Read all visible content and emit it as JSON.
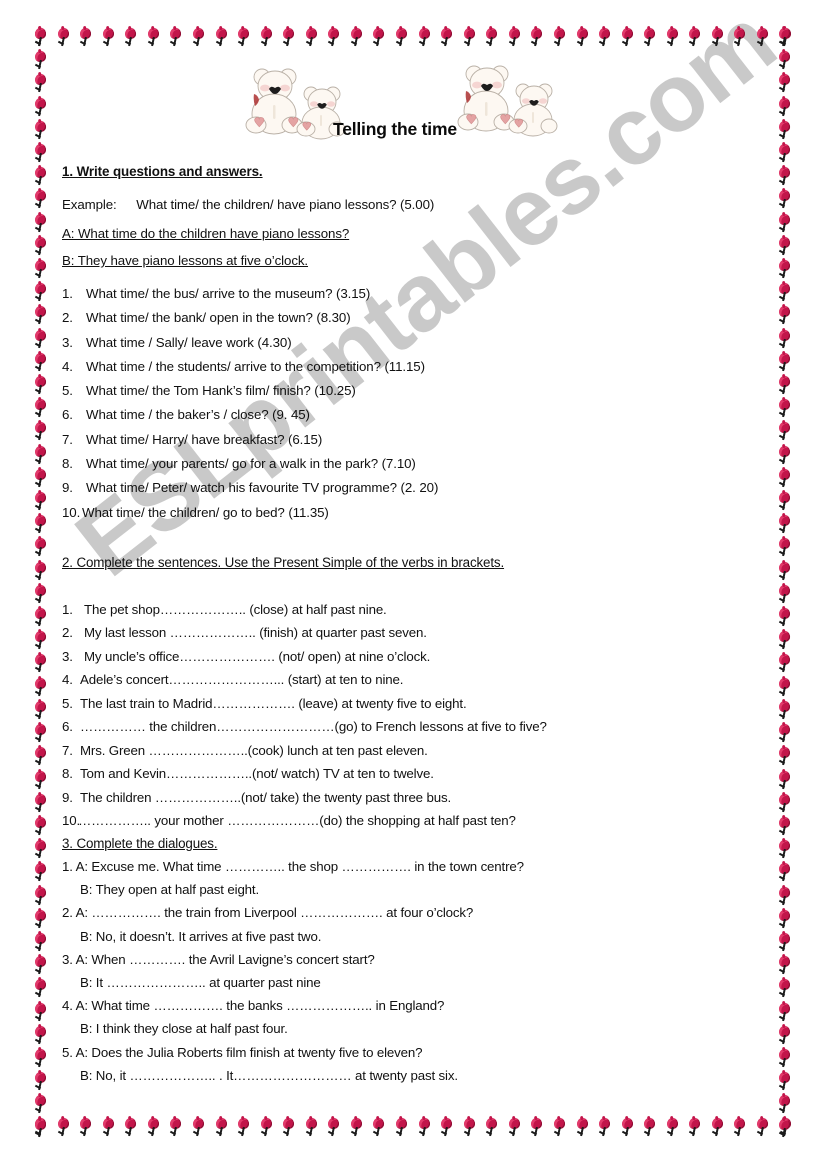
{
  "document": {
    "title": "Telling the time",
    "watermark": "ESLprintables.com",
    "decor": {
      "border_motif": "cherry",
      "border_color": "#c2154a",
      "bear_left": "teddy-bears-clipart",
      "bear_right": "teddy-bears-clipart"
    }
  },
  "section1": {
    "heading": "1. Write questions and answers.",
    "example_label": "Example:",
    "example_prompt": "What time/ the children/ have piano lessons? (5.00)",
    "answer_a": "A: What time do the children have piano lessons?",
    "answer_b": "B: They have piano lessons at five o’clock.",
    "items": [
      {
        "num": "1.",
        "text": "What time/ the bus/ arrive to the museum? (3.15)"
      },
      {
        "num": "2.",
        "text": "What time/ the bank/ open in the town? (8.30)"
      },
      {
        "num": "3.",
        "text": "What time / Sally/ leave work (4.30)"
      },
      {
        "num": "4.",
        "text": "What time / the students/ arrive to the competition? (11.15)"
      },
      {
        "num": "5.",
        "text": "What time/ the Tom Hank’s film/ finish? (10.25)"
      },
      {
        "num": "6.",
        "text": "What time / the baker’s / close? (9. 45)"
      },
      {
        "num": "7.",
        "text": "What time/ Harry/ have breakfast? (6.15)"
      },
      {
        "num": "8.",
        "text": "What time/ your parents/ go for a walk in the park? (7.10)"
      },
      {
        "num": "9.",
        "text": "What time/ Peter/ watch his favourite TV programme? (2. 20)"
      },
      {
        "num": "10.",
        "text": "What time/ the children/ go to bed? (11.35)"
      }
    ]
  },
  "section2": {
    "heading": "2. Complete the sentences. Use the Present Simple of the verbs in brackets.",
    "items": [
      {
        "num": "1.",
        "text": "The pet shop……………….. (close) at half past nine."
      },
      {
        "num": "2.",
        "text": "My last lesson ……………….. (finish) at quarter past seven."
      },
      {
        "num": "3.",
        "text": "My uncle’s office…………………. (not/ open) at nine o’clock."
      },
      {
        "num": "4.",
        "text": "Adele’s concert……………………... (start) at ten to nine."
      },
      {
        "num": "5.",
        "text": "The last train to Madrid………………. (leave) at twenty five to eight."
      },
      {
        "num": "6.",
        "text": "…………… the children………………………(go) to French lessons at five to five?"
      },
      {
        "num": "7.",
        "text": "Mrs. Green …………………..(cook) lunch at ten past eleven."
      },
      {
        "num": "8.",
        "text": "Tom and Kevin………………..(not/ watch) TV at ten to twelve."
      },
      {
        "num": "9.",
        "text": "The children ………………..(not/ take) the twenty past three bus."
      },
      {
        "num": "10.",
        "text": "…………….. your mother …………………(do) the shopping at half past ten?"
      }
    ]
  },
  "section3": {
    "heading": "3. Complete the dialogues.",
    "items": [
      {
        "a": "1. A: Excuse me. What time ………….. the shop ……………. in the town centre?",
        "b": "B: They open at half past eight."
      },
      {
        "a": "2. A: ……………. the train from Liverpool ………………. at four o’clock?",
        "b": "B: No, it doesn’t. It arrives at five past two."
      },
      {
        "a": "3. A: When …………. the Avril Lavigne’s concert start?",
        "b": "B: It ………………….. at quarter past nine"
      },
      {
        "a": "4. A: What time ……………. the banks ……………….. in England?",
        "b": "B: I think they close at half past four."
      },
      {
        "a": "5. A: Does the Julia Roberts film finish at twenty five  to eleven?",
        "b": "B: No, it ……………….. . It……………………… at twenty past six."
      }
    ]
  }
}
